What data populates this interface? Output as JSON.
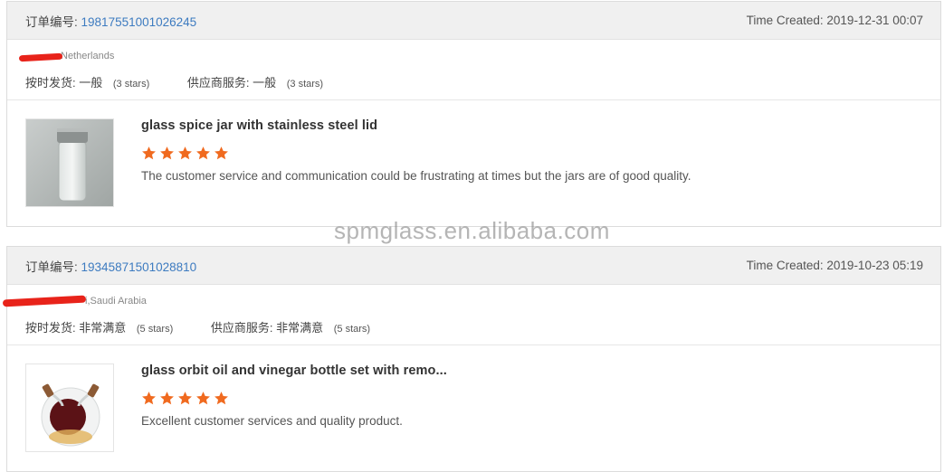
{
  "orders": [
    {
      "order_label": "订单编号:",
      "order_number": "19817551001026245",
      "time_label": "Time Created:",
      "time_value": "2019-12-31 00:07",
      "buyer_location": "Netherlands",
      "ontime_label": "按时发货:",
      "ontime_value": "一般",
      "ontime_stars": "(3 stars)",
      "supplier_label": "供应商服务:",
      "supplier_value": "一般",
      "supplier_stars": "(3 stars)",
      "product_title": "glass spice jar with stainless steel lid",
      "product_rating": 5,
      "review_text": "The customer service and communication could be frustrating at times but the jars are of good quality."
    },
    {
      "order_label": "订单编号:",
      "order_number": "19345871501028810",
      "time_label": "Time Created:",
      "time_value": "2019-10-23 05:19",
      "buyer_location": "i,Saudi Arabia",
      "ontime_label": "按时发货:",
      "ontime_value": "非常满意",
      "ontime_stars": "(5 stars)",
      "supplier_label": "供应商服务:",
      "supplier_value": "非常满意",
      "supplier_stars": "(5 stars)",
      "product_title": "glass orbit oil and vinegar bottle set with remo...",
      "product_rating": 5,
      "review_text": "Excellent customer services and quality product."
    }
  ],
  "watermark": "spmglass.en.alibaba.com",
  "colors": {
    "accent_link": "#3d7bc0",
    "star": "#f06a1f",
    "redaction": "#e8231a"
  },
  "icons": {
    "star": "star-icon"
  }
}
